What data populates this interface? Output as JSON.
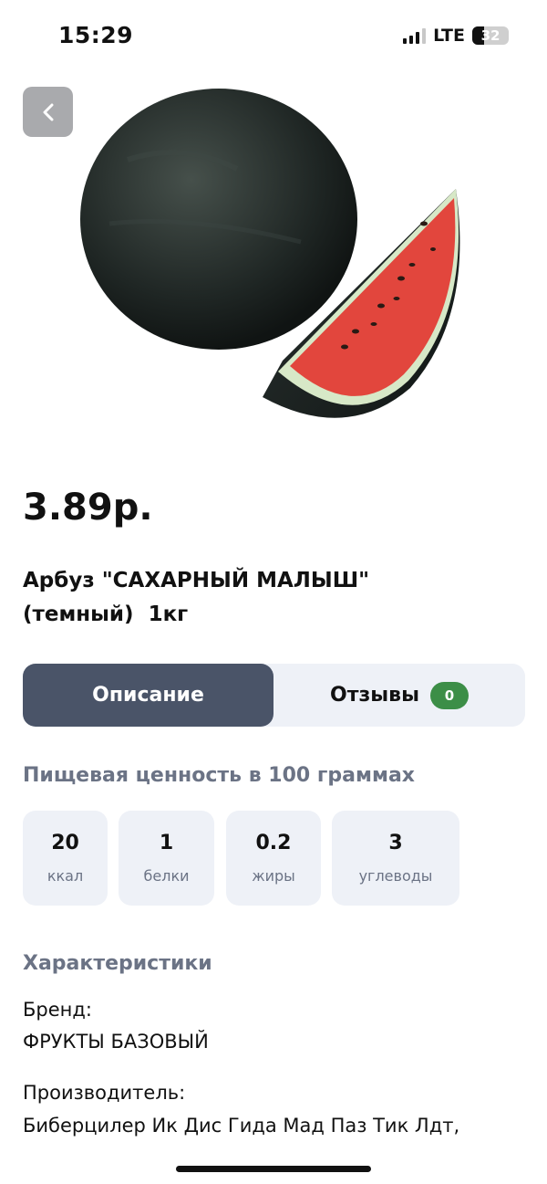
{
  "status_bar": {
    "time": "15:29",
    "network": "LTE",
    "battery": "32"
  },
  "product": {
    "image_icon": "watermelon-image",
    "price": "3.89р.",
    "title": "Арбуз \"САХАРНЫЙ МАЛЫШ\" (темный)  1кг"
  },
  "tabs": {
    "description": "Описание",
    "reviews": "Отзывы",
    "reviews_count": "0"
  },
  "nutrition": {
    "heading": "Пищевая ценность в 100 граммах",
    "items": [
      {
        "value": "20",
        "label": "ккал"
      },
      {
        "value": "1",
        "label": "белки"
      },
      {
        "value": "0.2",
        "label": "жиры"
      },
      {
        "value": "3",
        "label": "углеводы"
      }
    ]
  },
  "characteristics": {
    "heading": "Характеристики",
    "brand_label": "Бренд:",
    "brand_value": "ФРУКТЫ БАЗОВЫЙ",
    "manufacturer_label": "Производитель:",
    "manufacturer_value": "Биберцилер Ик Дис Гида Мад Паз Тик Лдт,"
  },
  "colors": {
    "tab_active": "#4a5468",
    "tab_bg": "#eef1f7",
    "badge": "#3c8e47",
    "muted_heading": "#6b7385"
  }
}
